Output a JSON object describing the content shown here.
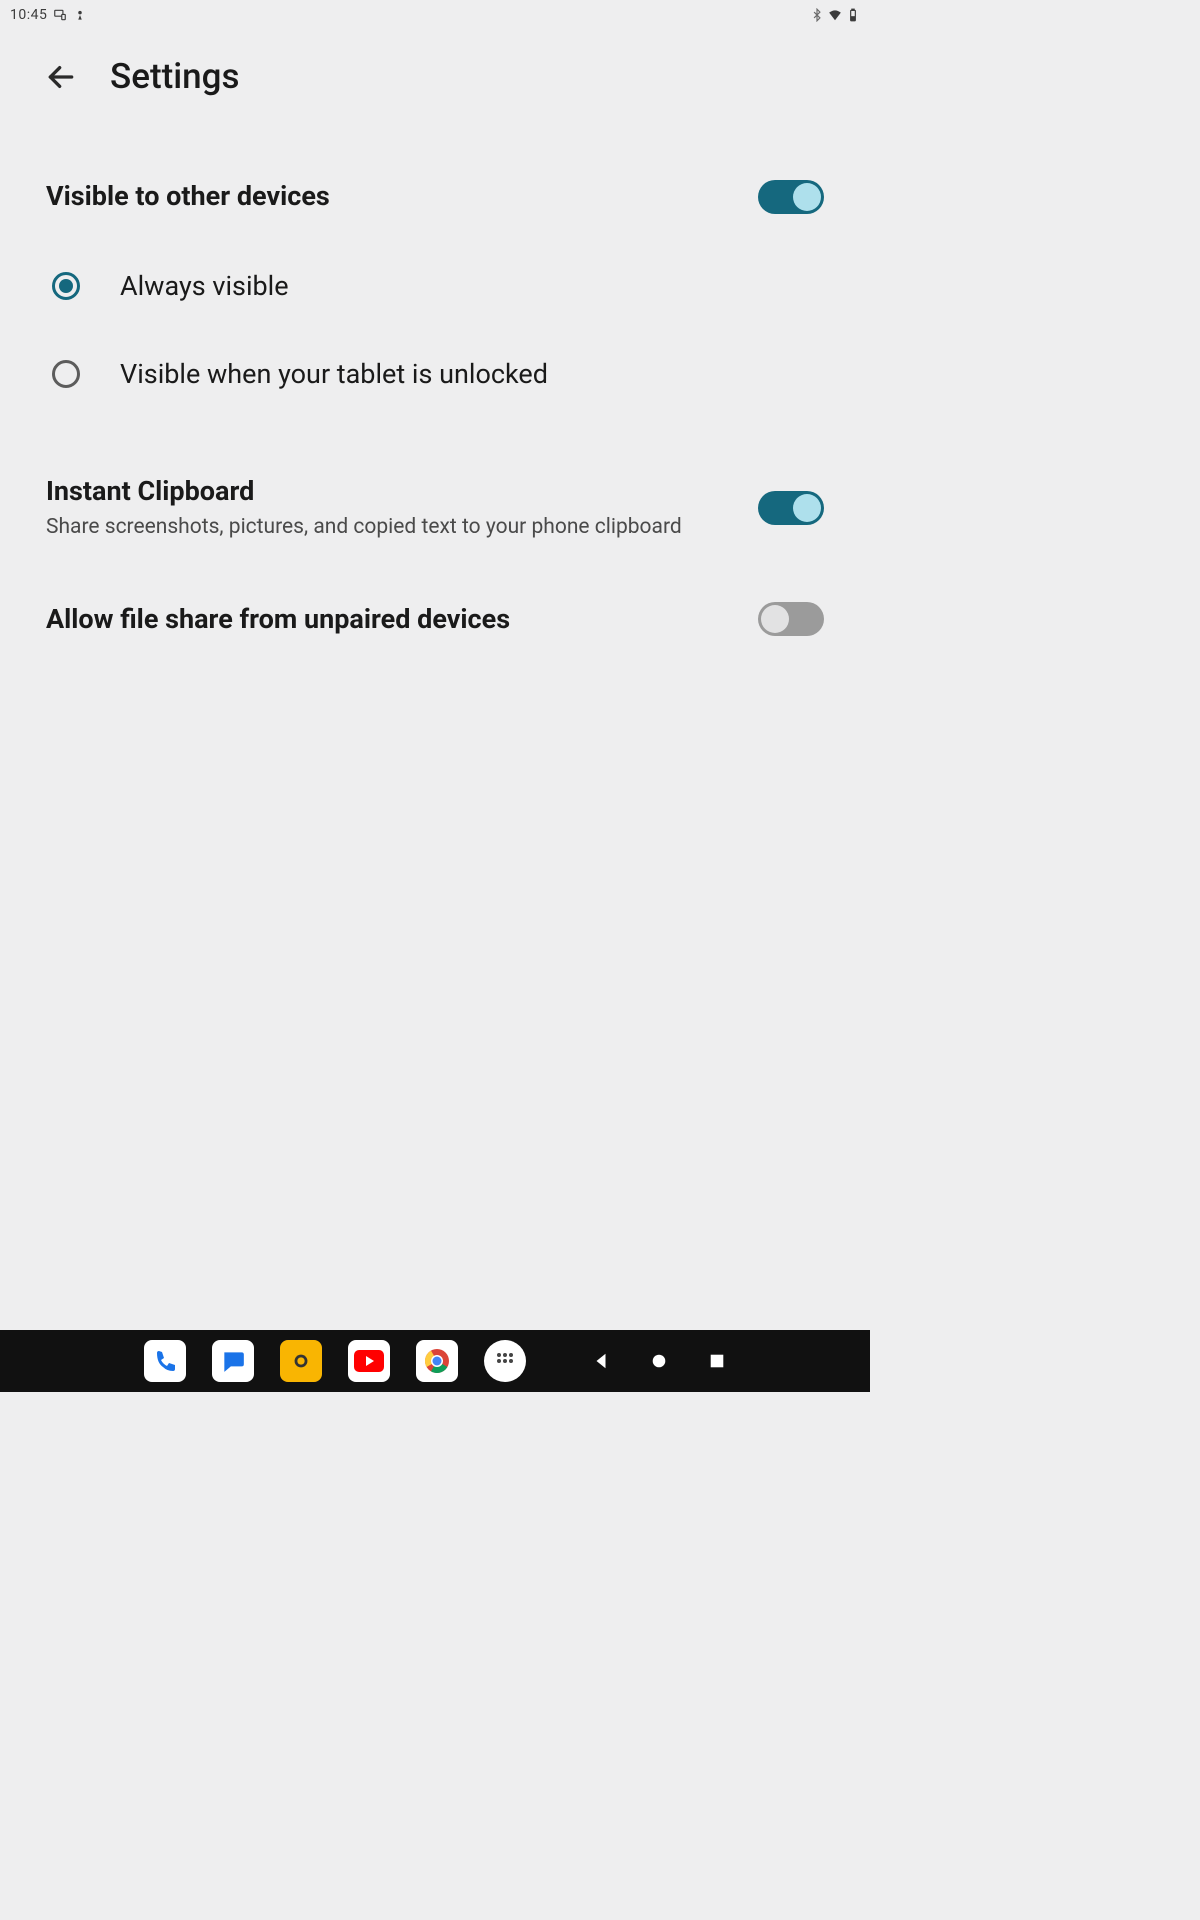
{
  "status": {
    "time": "10:45"
  },
  "header": {
    "title": "Settings"
  },
  "settings": {
    "visible": {
      "title": "Visible to other devices",
      "toggle_on": true,
      "options": [
        {
          "label": "Always visible",
          "selected": true
        },
        {
          "label": "Visible when your tablet is unlocked",
          "selected": false
        }
      ]
    },
    "clipboard": {
      "title": "Instant Clipboard",
      "subtitle": "Share screenshots, pictures, and copied text to your phone clipboard",
      "toggle_on": true
    },
    "fileshare": {
      "title": "Allow file share from unpaired devices",
      "toggle_on": false
    }
  },
  "colors": {
    "accent": "#15687e",
    "knob_on": "#aee0ec",
    "toggle_off": "#9b9b9b"
  }
}
